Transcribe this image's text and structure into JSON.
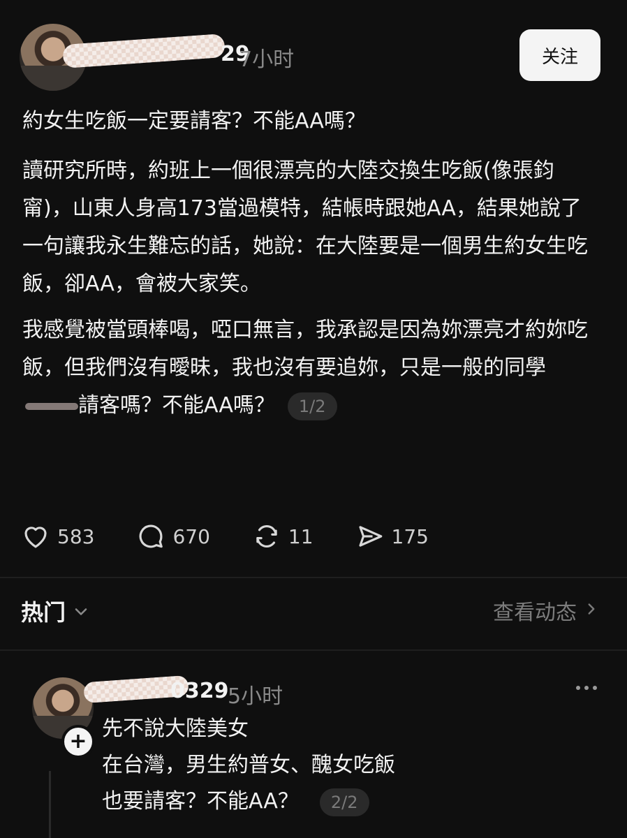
{
  "post": {
    "username_visible": "29",
    "timestamp": "7小时",
    "follow_label": "关注",
    "title": "約女生吃飯一定要請客？不能AA嗎？",
    "paragraph1": "讀研究所時，約班上一個很漂亮的大陸交換生吃飯(像張鈞甯)，山東人身高173當過模特，結帳時跟她AA，結果她說了一句讓我永生難忘的話，她說：在大陸要是一個男生約女生吃飯，卻AA，會被大家笑。",
    "paragraph2_before": "我感覺被當頭棒喝，啞口無言，我承認是因為妳漂亮才約妳吃飯，但我們沒有曖昧，我也沒有要追妳，只是一般的同學",
    "paragraph2_after": "請客嗎？不能AA嗎？",
    "page_indicator": "1/2"
  },
  "actions": {
    "likes": "583",
    "comments": "670",
    "reposts": "11",
    "shares": "175"
  },
  "tabs": {
    "hot_label": "热门",
    "view_activity_label": "查看动态"
  },
  "comment": {
    "username_visible": "0329",
    "timestamp": "5小时",
    "plus_label": "+",
    "line1": "先不說大陸美女",
    "line2": "在台灣，男生約普女、醜女吃飯",
    "line3": "也要請客？不能AA？",
    "page_indicator": "2/2"
  }
}
